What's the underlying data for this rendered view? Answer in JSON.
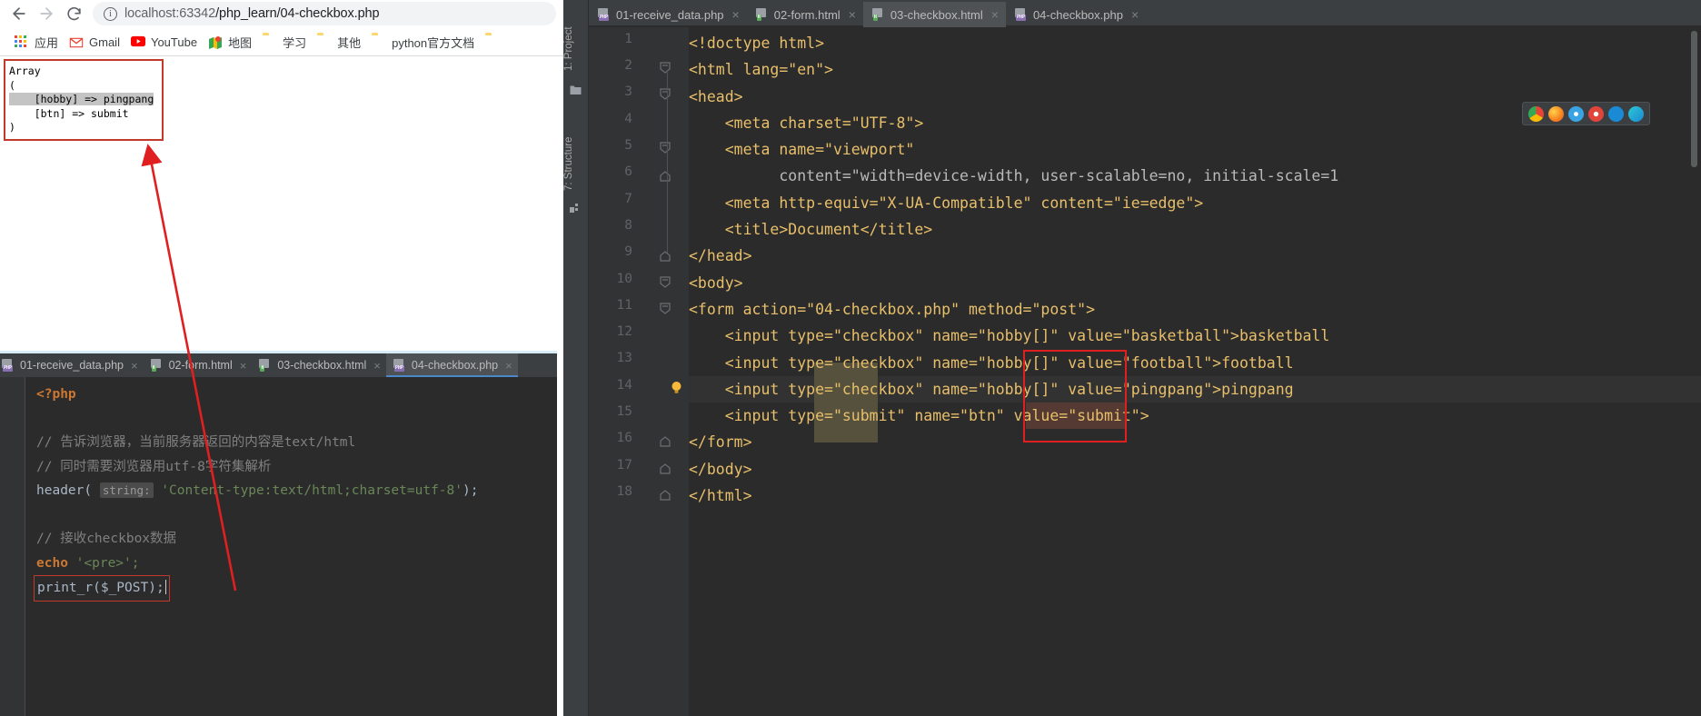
{
  "browser": {
    "nav": {
      "back_icon": "arrow-left-icon",
      "forward_icon": "arrow-right-icon",
      "reload_icon": "reload-icon"
    },
    "omnibox": {
      "info_icon": "page-info-icon",
      "host": "localhost:63342",
      "path": "/php_learn/04-checkbox.php",
      "url": "localhost:63342/php_learn/04-checkbox.php"
    },
    "bookmarks": [
      {
        "label": "应用",
        "icon": "apps-grid-icon"
      },
      {
        "label": "Gmail",
        "icon": "gmail-icon"
      },
      {
        "label": "YouTube",
        "icon": "youtube-icon"
      },
      {
        "label": "地图",
        "icon": "maps-icon"
      },
      {
        "label": "学习",
        "icon": "folder-icon"
      },
      {
        "label": "其他",
        "icon": "folder-icon"
      },
      {
        "label": "python官方文档",
        "icon": "folder-icon"
      },
      {
        "label": "",
        "icon": "folder-icon"
      }
    ],
    "page_output": "Array\n(\n    [hobby] => pingpang\n    [btn] => submit\n)",
    "page_output_lines": {
      "l1": "Array",
      "l2": "(",
      "l3": "    [hobby] => pingpang",
      "l4": "    [btn] => submit",
      "l5": ")"
    },
    "highlight_color": "#c0392b"
  },
  "ide_bottom": {
    "tabs": [
      {
        "label": "01-receive_data.php",
        "icon": "php-file-icon",
        "active": false,
        "close_icon": "close-icon"
      },
      {
        "label": "02-form.html",
        "icon": "html-file-icon",
        "active": false,
        "close_icon": "close-icon"
      },
      {
        "label": "03-checkbox.html",
        "icon": "html-file-icon",
        "active": false,
        "close_icon": "close-icon"
      },
      {
        "label": "04-checkbox.php",
        "icon": "php-file-icon",
        "active": true,
        "close_icon": "close-icon"
      }
    ],
    "code": {
      "open_tag": "<?php",
      "comment1": "// 告诉浏览器，当前服务器返回的内容是text/html",
      "comment2": "// 同时需要浏览器用utf-8字符集解析",
      "header_fn": "header(",
      "header_hint": "string:",
      "header_arg": "'Content-type:text/html;charset=utf-8'",
      "header_end": ");",
      "comment3": "// 接收checkbox数据",
      "echo_kw": "echo",
      "echo_arg": "'<pre>';",
      "printr": "print_r($_POST);"
    }
  },
  "ide_main": {
    "left_strip": {
      "project_label": "1: Project",
      "structure_label": "7: Structure",
      "folder_icon": "folder-icon",
      "module_icon": "modules-icon"
    },
    "tabs": [
      {
        "label": "01-receive_data.php",
        "icon": "php-file-icon",
        "active": false,
        "close_icon": "close-icon"
      },
      {
        "label": "02-form.html",
        "icon": "html-file-icon",
        "active": false,
        "close_icon": "close-icon"
      },
      {
        "label": "03-checkbox.html",
        "icon": "html-file-icon",
        "active": true,
        "close_icon": "close-icon"
      },
      {
        "label": "04-checkbox.php",
        "icon": "php-file-icon",
        "active": false,
        "close_icon": "close-icon"
      }
    ],
    "browser_strip": {
      "icons": [
        "chrome-icon",
        "firefox-icon",
        "safari-icon",
        "opera-icon",
        "edge-legacy-icon",
        "edge-icon"
      ]
    },
    "current_line": 14,
    "bulb_icon": "intention-bulb-icon",
    "lines": [
      {
        "n": 1,
        "text": "<!doctype html>"
      },
      {
        "n": 2,
        "text": "<html lang=\"en\">"
      },
      {
        "n": 3,
        "text": "<head>"
      },
      {
        "n": 4,
        "text": "    <meta charset=\"UTF-8\">"
      },
      {
        "n": 5,
        "text": "    <meta name=\"viewport\""
      },
      {
        "n": 6,
        "text": "          content=\"width=device-width, user-scalable=no, initial-scale=1"
      },
      {
        "n": 7,
        "text": "    <meta http-equiv=\"X-UA-Compatible\" content=\"ie=edge\">"
      },
      {
        "n": 8,
        "text": "    <title>Document</title>"
      },
      {
        "n": 9,
        "text": "</head>"
      },
      {
        "n": 10,
        "text": "<body>"
      },
      {
        "n": 11,
        "text": "<form action=\"04-checkbox.php\" method=\"post\">"
      },
      {
        "n": 12,
        "text": "    <input type=\"checkbox\" name=\"hobby[]\" value=\"basketball\">basketball"
      },
      {
        "n": 13,
        "text": "    <input type=\"checkbox\" name=\"hobby[]\" value=\"football\">football"
      },
      {
        "n": 14,
        "text": "    <input type=\"checkbox\" name=\"hobby[]\" value=\"pingpang\">pingpang"
      },
      {
        "n": 15,
        "text": "    <input type=\"submit\" name=\"btn\" value=\"submit\">"
      },
      {
        "n": 16,
        "text": "</form>"
      },
      {
        "n": 17,
        "text": "</body>"
      },
      {
        "n": 18,
        "text": "</html>"
      }
    ]
  },
  "annotations": {
    "arrow_color": "#e02020",
    "box_color": "#e02020",
    "arrow_desc": "red-arrow-from-print_r-to-browser-output"
  }
}
